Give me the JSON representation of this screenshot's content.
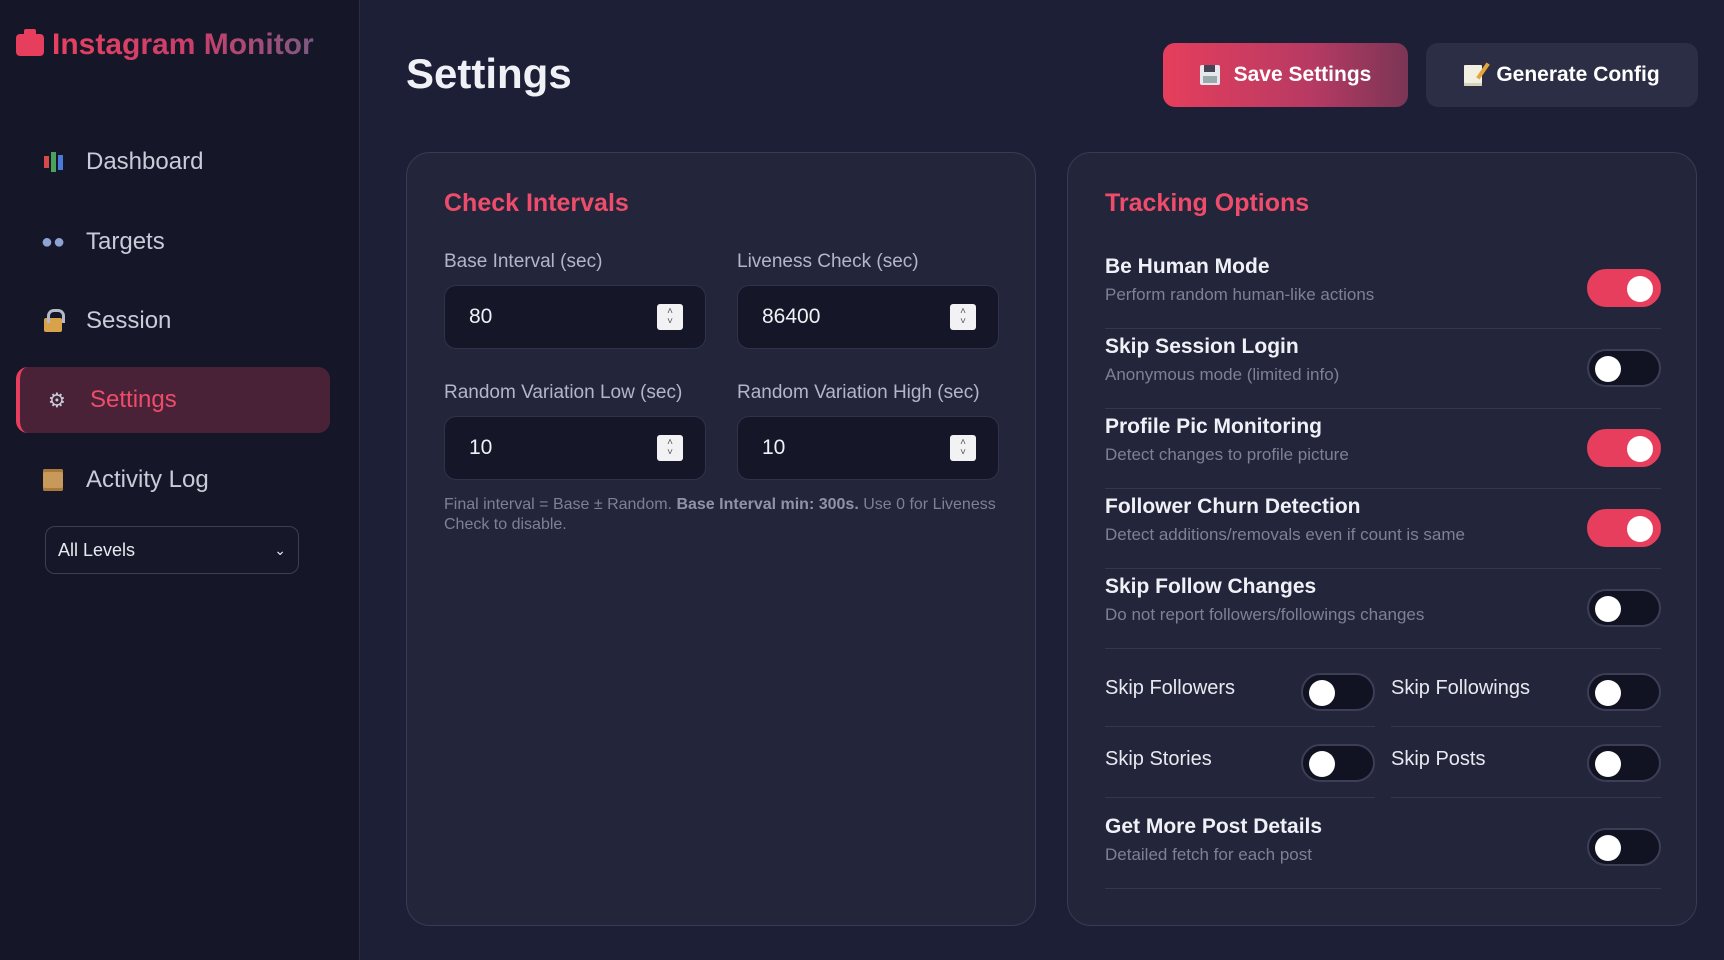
{
  "app": {
    "title": "Instagram Monitor"
  },
  "colors": {
    "accent": "#e63e5c",
    "background": "#1c1f35",
    "sidebar": "#151728",
    "card": "#23263b"
  },
  "sidebar": {
    "items": [
      {
        "label": "Dashboard",
        "icon": "bar-chart-icon",
        "active": false
      },
      {
        "label": "Targets",
        "icon": "people-icon",
        "active": false
      },
      {
        "label": "Session",
        "icon": "lock-icon",
        "active": false
      },
      {
        "label": "Settings",
        "icon": "gear-icon",
        "active": true
      },
      {
        "label": "Activity Log",
        "icon": "scroll-icon",
        "active": false
      }
    ],
    "level_filter": {
      "selected": "All Levels"
    }
  },
  "header": {
    "title": "Settings",
    "save_label": "Save Settings",
    "config_label": "Generate Config"
  },
  "intervals": {
    "title": "Check Intervals",
    "fields": [
      {
        "label": "Base Interval (sec)",
        "value": "80"
      },
      {
        "label": "Liveness Check (sec)",
        "value": "86400"
      },
      {
        "label": "Random Variation Low (sec)",
        "value": "10"
      },
      {
        "label": "Random Variation High (sec)",
        "value": "10"
      }
    ],
    "hint_pre": "Final interval = Base ± Random. ",
    "hint_bold": "Base Interval min: 300s.",
    "hint_post": " Use 0 for Liveness Check to disable."
  },
  "tracking": {
    "title": "Tracking Options",
    "options": [
      {
        "title": "Be Human Mode",
        "desc": "Perform random human-like actions",
        "enabled": true
      },
      {
        "title": "Skip Session Login",
        "desc": "Anonymous mode (limited info)",
        "enabled": false
      },
      {
        "title": "Profile Pic Monitoring",
        "desc": "Detect changes to profile picture",
        "enabled": true
      },
      {
        "title": "Follower Churn Detection",
        "desc": "Detect additions/removals even if count is same",
        "enabled": true
      },
      {
        "title": "Skip Follow Changes",
        "desc": "Do not report followers/followings changes",
        "enabled": false
      }
    ],
    "small_options": [
      {
        "label": "Skip Followers",
        "enabled": false
      },
      {
        "label": "Skip Followings",
        "enabled": false
      },
      {
        "label": "Skip Stories",
        "enabled": false
      },
      {
        "label": "Skip Posts",
        "enabled": false
      }
    ],
    "last_option": {
      "title": "Get More Post Details",
      "desc": "Detailed fetch for each post",
      "enabled": false
    }
  }
}
